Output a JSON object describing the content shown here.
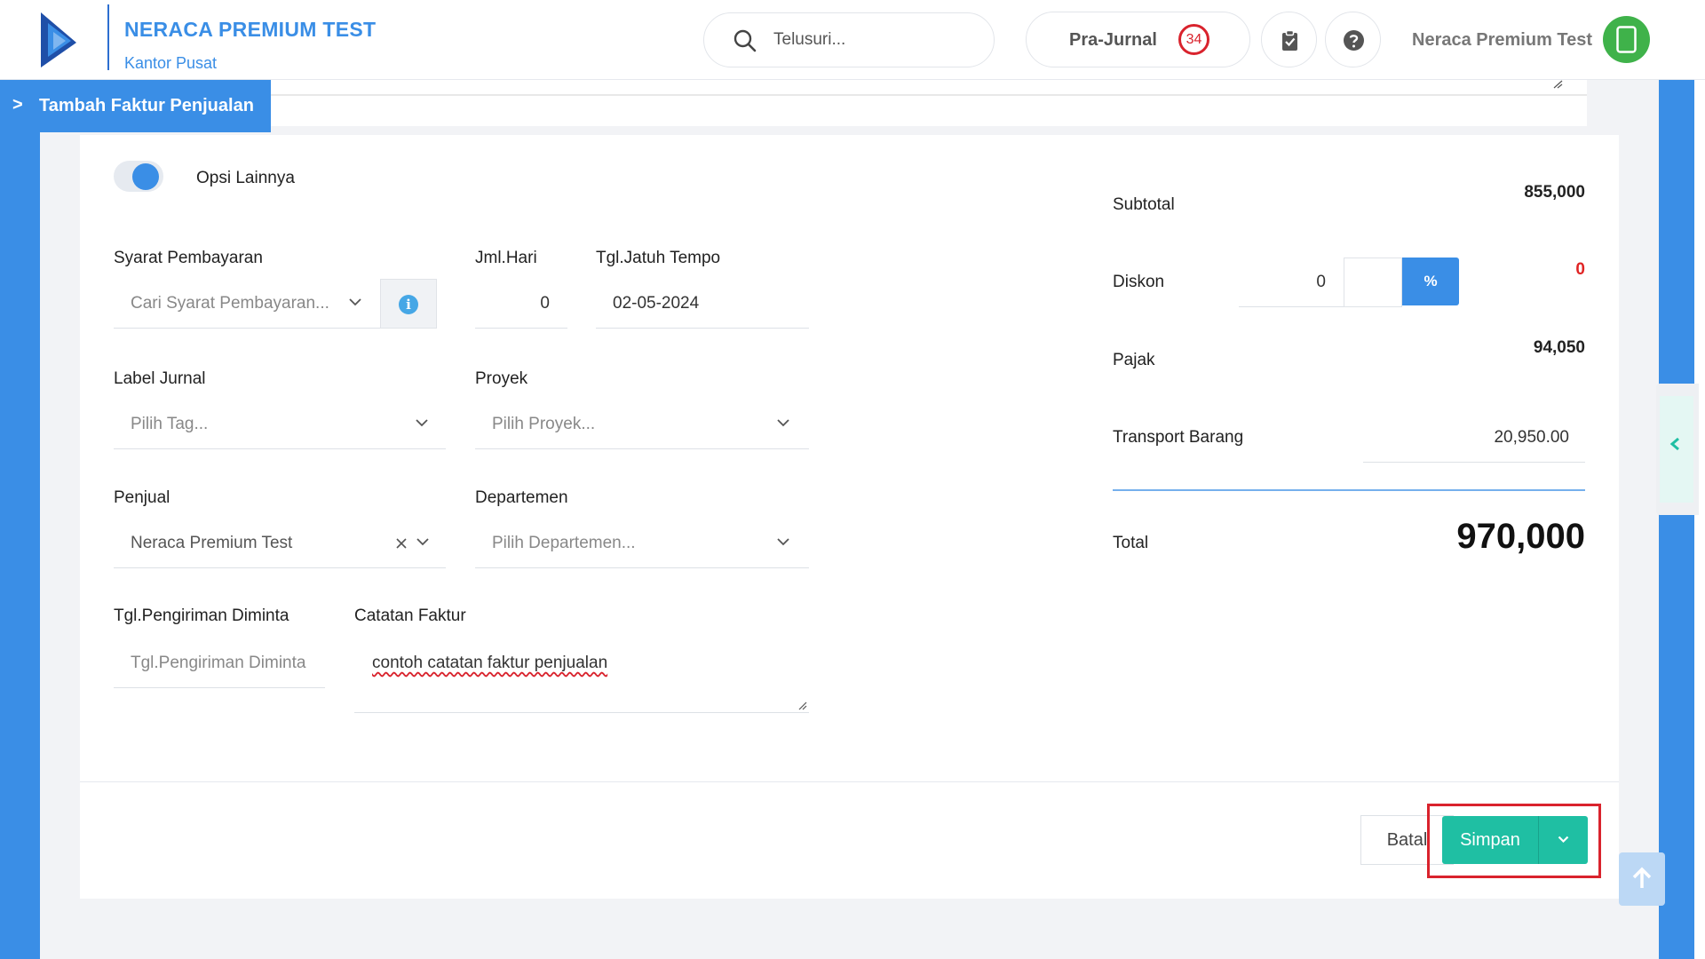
{
  "header": {
    "company_name": "NERACA PREMIUM TEST",
    "branch": "Kantor Pusat",
    "search_placeholder": "Telusuri...",
    "pra_jurnal_label": "Pra-Jurnal",
    "pra_jurnal_count": "34",
    "user_name": "Neraca Premium Test"
  },
  "page_tab": {
    "chevron": ">",
    "title": "Tambah Faktur Penjualan"
  },
  "form": {
    "toggle_label": "Opsi Lainnya",
    "toggle_on": true,
    "syarat_label": "Syarat Pembayaran",
    "syarat_placeholder": "Cari Syarat Pembayaran...",
    "jml_hari_label": "Jml.Hari",
    "jml_hari_value": "0",
    "jatuh_tempo_label": "Tgl.Jatuh Tempo",
    "jatuh_tempo_value": "02-05-2024",
    "label_jurnal_label": "Label Jurnal",
    "label_jurnal_placeholder": "Pilih Tag...",
    "proyek_label": "Proyek",
    "proyek_placeholder": "Pilih Proyek...",
    "penjual_label": "Penjual",
    "penjual_value": "Neraca Premium Test",
    "departemen_label": "Departemen",
    "departemen_placeholder": "Pilih Departemen...",
    "tgl_pengiriman_label": "Tgl.Pengiriman Diminta",
    "tgl_pengiriman_placeholder": "Tgl.Pengiriman Diminta",
    "catatan_label": "Catatan Faktur",
    "catatan_value": "contoh catatan faktur penjualan"
  },
  "summary": {
    "subtotal_label": "Subtotal",
    "subtotal_value": "855,000",
    "diskon_label": "Diskon",
    "diskon_input": "0",
    "diskon_unit": "%",
    "diskon_value": "0",
    "pajak_label": "Pajak",
    "pajak_value": "94,050",
    "transport_label": "Transport Barang",
    "transport_value": "20,950.00",
    "total_label": "Total",
    "total_value": "970,000"
  },
  "actions": {
    "batal_label": "Batal",
    "simpan_label": "Simpan"
  },
  "colors": {
    "primary_blue": "#3a8ee6",
    "save_teal": "#1fbfa3",
    "badge_red": "#d9232d",
    "avatar_green": "#3fb24a"
  }
}
